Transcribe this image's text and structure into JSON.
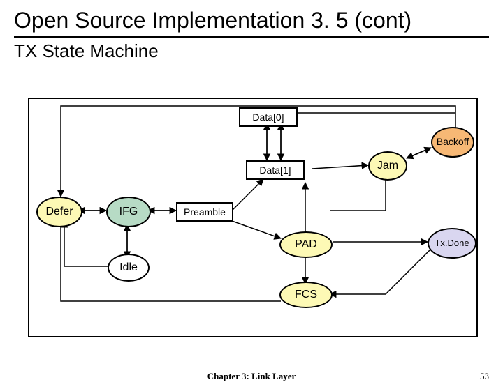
{
  "title": "Open Source Implementation 3. 5 (cont)",
  "subtitle": "TX State Machine",
  "nodes": {
    "data0": "Data[0]",
    "data1": "Data[1]",
    "backoff": "Backoff",
    "jam": "Jam",
    "defer": "Defer",
    "ifg": "IFG",
    "preamble": "Preamble",
    "pad": "PAD",
    "txdone": "Tx.Done",
    "idle": "Idle",
    "fcs": "FCS"
  },
  "colors": {
    "yellow": "#fdf9b5",
    "orange": "#f7b875",
    "green": "#b7dbc5",
    "lilac": "#d9d6f0",
    "white": "#ffffff"
  },
  "footer": {
    "center": "Chapter 3: Link Layer",
    "right": "53"
  }
}
